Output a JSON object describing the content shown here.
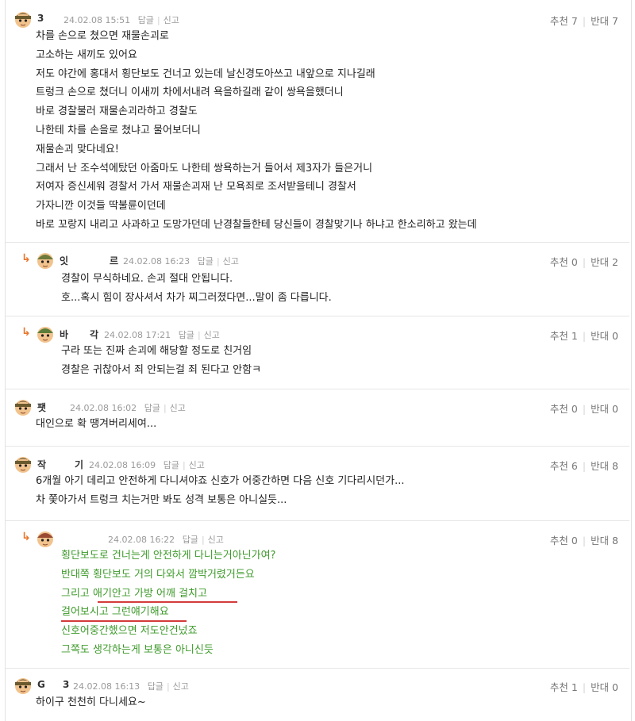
{
  "comments": [
    {
      "nick": "3",
      "date": "24.02.08 15:51",
      "reply_label": "답글",
      "report_label": "신고",
      "votes": {
        "up_label": "추천 7",
        "down_label": "반대 7"
      },
      "lines": [
        "차를 손으로 쳤으면 재물손괴로",
        "고소하는 새끼도 있어요",
        "저도 야간에 홍대서 횡단보도 건너고 있는데 날신경도아쓰고 내앞으로 지나길래",
        "트렁크 손으로 쳤더니 이새끼 차에서내려 욕을하길래 같이 쌍욕을했더니",
        "바로 경찰불러 재물손괴라하고 경찰도",
        "나한테 차를 손을로 쳤냐고 물어보더니",
        "재물손괴 맞다네요!",
        "그래서 난 조수석에탔던 아줌마도 나한테 쌍욕하는거 들어서 제3자가 들은거니",
        "저여자 증신세워 경찰서 가서 재물손괴재 난 모욕죄로 조서받을테니 경찰서",
        "가자니깐 이것들 딱불륜이던데",
        "바로 꼬랑지 내리고 사과하고 도망가던데 난경찰들한테 당신들이 경찰맞기나 하냐고 한소리하고 왔는데"
      ]
    },
    {
      "nick": "잇",
      "nick2": "르",
      "date": "24.02.08 16:23",
      "reply_label": "답글",
      "report_label": "신고",
      "votes": {
        "up_label": "추천 0",
        "down_label": "반대 2"
      },
      "lines": [
        "경찰이 무식하네요. 손괴 절대 안됩니다.",
        "호...혹시 힘이 장사셔서 차가 찌그러졌다면...말이 좀 다릅니다."
      ]
    },
    {
      "nick": "바",
      "nick2": "각",
      "date": "24.02.08 17:21",
      "reply_label": "답글",
      "report_label": "신고",
      "votes": {
        "up_label": "추천 1",
        "down_label": "반대 0"
      },
      "lines": [
        "구라 또는 진짜 손괴에 해당할 정도로 친거임",
        "경찰은 귀찮아서 죄 안되는걸 죄 된다고 안함ㅋ"
      ]
    },
    {
      "nick": "팻",
      "date": "24.02.08 16:02",
      "reply_label": "답글",
      "report_label": "신고",
      "votes": {
        "up_label": "추천 0",
        "down_label": "반대 0"
      },
      "lines": [
        "대인으로 확 땡겨버리세여..."
      ]
    },
    {
      "nick": "작",
      "nick2": "기",
      "date": "24.02.08 16:09",
      "reply_label": "답글",
      "report_label": "신고",
      "votes": {
        "up_label": "추천 6",
        "down_label": "반대 8"
      },
      "lines": [
        "6개월 아기 데리고 안전하게 다니셔야죠 신호가 어중간하면 다음 신호 기다리시던가...",
        "차 쫓아가서 트렁크 치는거만 봐도 성격 보통은 아니실듯..."
      ]
    },
    {
      "date": "24.02.08 16:22",
      "reply_label": "답글",
      "report_label": "신고",
      "votes": {
        "up_label": "추천 0",
        "down_label": "반대 8"
      },
      "text_color": "#3d9a2a",
      "lines": [
        "횡단보도로 건너는게 안전하게 다니는거아닌가여?",
        "반대쪽 횡단보도 거의 다와서 깜박거렸거든요",
        "그리고 애기안고 가방 어깨 걸치고",
        "걸어보시고 그런얘기해요",
        "신호어중간했으면 저도안건넜죠",
        "그쪽도 생각하는게 보통은 아니신듯"
      ]
    },
    {
      "nick": "G",
      "nick2": "3",
      "date": "24.02.08 16:13",
      "reply_label": "답글",
      "report_label": "신고",
      "votes": {
        "up_label": "추천 1",
        "down_label": "반대 0"
      },
      "lines": [
        "하이구 천천히 다니세요~"
      ]
    }
  ],
  "reply_arrow": "↳",
  "colors": {
    "accent_reply": "#e8772e",
    "green_text": "#3d9a2a",
    "underline": "#d43b3b"
  }
}
